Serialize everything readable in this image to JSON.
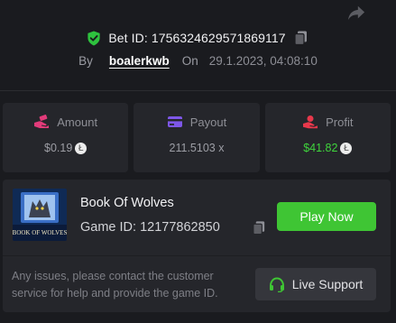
{
  "header": {
    "bet_id": "Bet ID: 1756324629571869117",
    "by_label": "By",
    "username": "boalerkwb",
    "on_label": "On",
    "timestamp": "29.1.2023, 04:08:10"
  },
  "stats": {
    "amount": {
      "label": "Amount",
      "value": "$0.19",
      "icon": "bet-hand-icon",
      "color": "#e23b7a"
    },
    "payout": {
      "label": "Payout",
      "value": "211.5103 x",
      "icon": "wallet-card-icon",
      "color": "#7e57e8"
    },
    "profit": {
      "label": "Profit",
      "value": "$41.82",
      "icon": "coins-hand-icon",
      "color": "#e8384b",
      "value_color": "#3fd43c"
    }
  },
  "game": {
    "name": "Book Of Wolves",
    "id": "Game ID: 12177862850",
    "thumbnail_text": "BOOK OF WOLVES",
    "play_label": "Play Now"
  },
  "support": {
    "message": "Any issues, please contact the customer service for help and provide the game ID.",
    "button_label": "Live Support"
  },
  "colors": {
    "background": "#1a1b1f",
    "card": "#25262b",
    "accent_green": "#3fc534",
    "shield_green": "#2ec23e"
  },
  "coin_symbol": "Ł"
}
